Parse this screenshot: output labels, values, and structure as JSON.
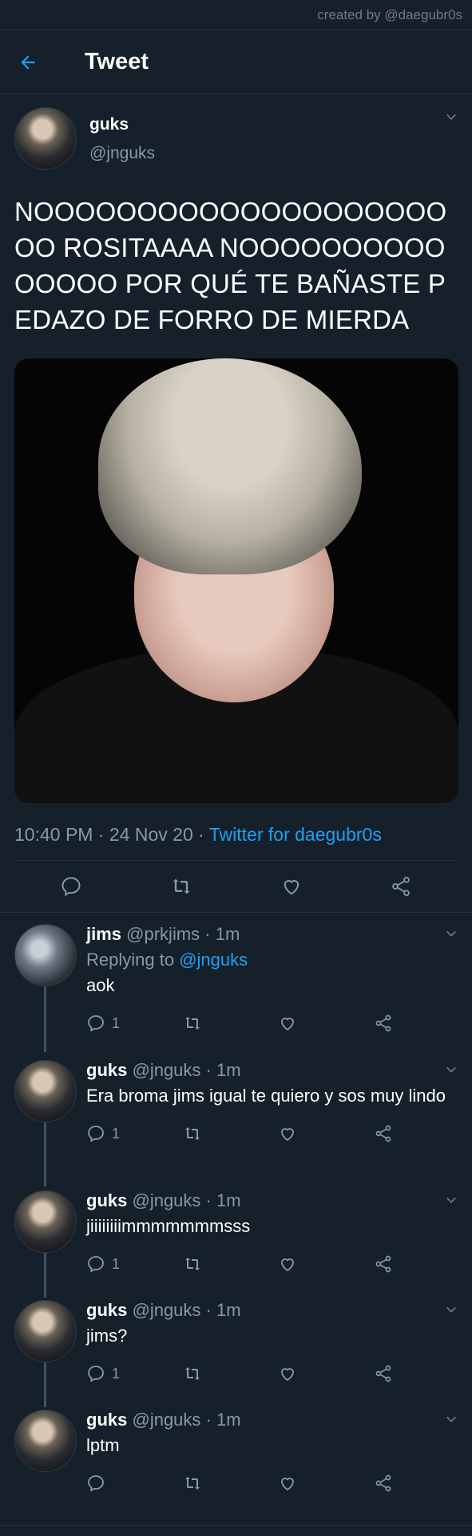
{
  "credit": "created by @daegubr0s",
  "header": {
    "title": "Tweet"
  },
  "main_tweet": {
    "name": "guks",
    "handle": "@jnguks",
    "text": "NOOOOOOOOOOOOOOOOOOOOOO ROSITAAAA NOOOOOOOOOOOOOOO POR QUÉ TE BAÑASTE PEDAZO DE FORRO DE MIERDA",
    "timestamp": "10:40 PM · 24 Nov 20 · ",
    "source": "Twitter for daegubr0s"
  },
  "replies": [
    {
      "name": "jims",
      "meta": "@prkjims · 1m",
      "replying_prefix": "Replying to ",
      "replying_to": "@jnguks",
      "text": "aok",
      "reply_count": "1"
    },
    {
      "name": "guks",
      "meta": "@jnguks · 1m",
      "text": "Era broma jims igual te quiero y sos muy lindo",
      "reply_count": "1"
    },
    {
      "name": "guks",
      "meta": "@jnguks · 1m",
      "text": "jiiiiiiiimmmmmmmsss",
      "reply_count": "1"
    },
    {
      "name": "guks",
      "meta": "@jnguks · 1m",
      "text": "jims?",
      "reply_count": "1"
    },
    {
      "name": "guks",
      "meta": "@jnguks · 1m",
      "text": "lptm",
      "reply_count": ""
    }
  ],
  "colors": {
    "background": "#15202b",
    "accent": "#1da1f2",
    "muted": "#8899a6"
  },
  "icons": [
    "back-arrow-icon",
    "chevron-down-icon",
    "reply-icon",
    "retweet-icon",
    "like-icon",
    "share-icon"
  ]
}
